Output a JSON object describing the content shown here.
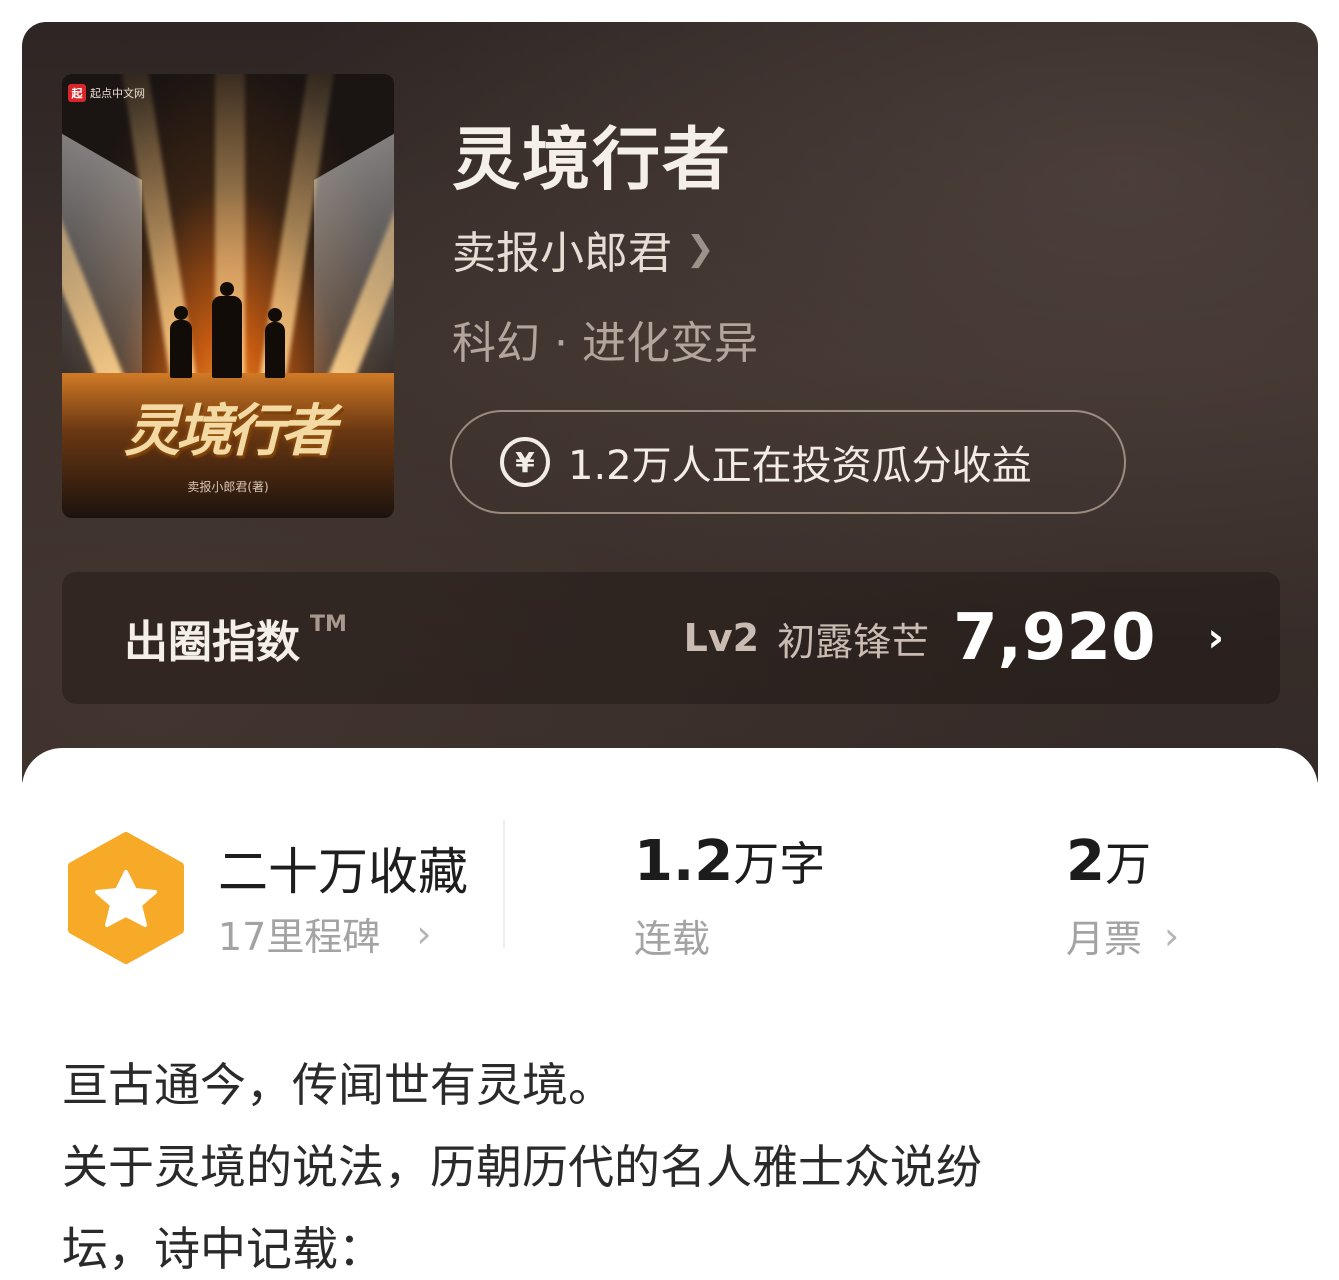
{
  "book": {
    "title": "灵境行者",
    "author": "卖报小郎君",
    "genre": "科幻 · 进化变异",
    "invest_text": "1.2万人正在投资瓜分收益",
    "cover": {
      "publisher_logo": "起",
      "publisher": "起点中文网",
      "title": "灵境行者",
      "author_line": "卖报小郎君(著)"
    }
  },
  "index": {
    "label": "出圈指数",
    "tm": "TM",
    "level": "Lv2",
    "level_name": "初露锋芒",
    "score": "7,920"
  },
  "stats": {
    "favorites_title": "二十万收藏",
    "milestones": "17里程碑",
    "words_num": "1.2",
    "words_unit": "万字",
    "words_label": "连载",
    "tickets_num": "2",
    "tickets_unit": "万",
    "tickets_label": "月票"
  },
  "description": {
    "line1": "亘古通今，传闻世有灵境。",
    "line2": "关于灵境的说法，历朝历代的名人雅士众说纷",
    "line3": "坛，诗中记载："
  },
  "icons": {
    "author_chevron": "chevron-right-icon",
    "invest": "yen-coin-icon",
    "badge": "star-hexagon-icon"
  },
  "colors": {
    "badge_orange": "#f7a928",
    "hero_dark": "#342a27"
  }
}
